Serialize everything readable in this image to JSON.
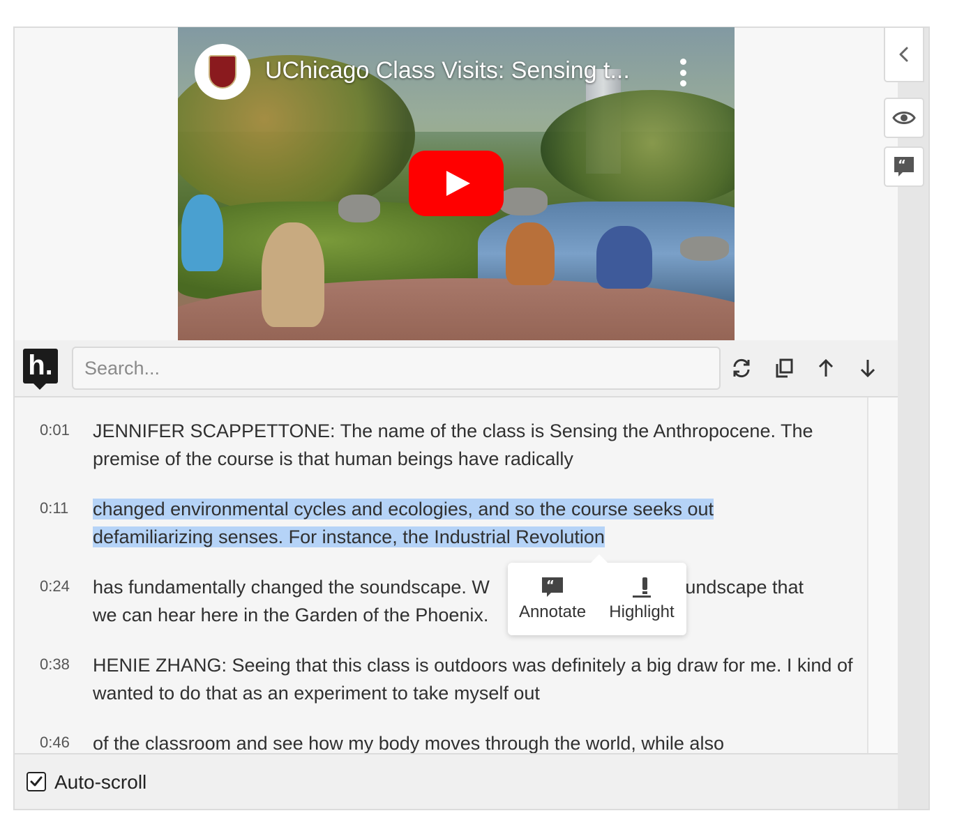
{
  "video": {
    "title": "UChicago Class Visits: Sensing t...",
    "channel_logo": "uchicago-shield-logo",
    "play_icon": "youtube-play-icon"
  },
  "sidebar": {
    "collapse_icon": "chevron-left-icon",
    "visibility_icon": "eye-icon",
    "annotations_icon": "quote-bubble-icon"
  },
  "toolbar": {
    "logo_text": "h.",
    "search_placeholder": "Search...",
    "icons": [
      "sync-icon",
      "copy-icon",
      "arrow-up-icon",
      "arrow-down-icon"
    ]
  },
  "transcript": [
    {
      "time": "0:01",
      "text": "JENNIFER SCAPPETTONE: The name of the class is Sensing the Anthropocene. The premise of the course is that human beings have radically"
    },
    {
      "time": "0:11",
      "text": "changed environmental cycles and ecologies, and so the course seeks out defamiliarizing senses. For instance, the Industrial Revolution",
      "highlighted": true
    },
    {
      "time": "0:24",
      "text_line1_start": "has fundamentally changed the soundscape. W",
      "text_line1_end": "soundscape that",
      "text_line2": "we can hear here in the Garden of the Phoenix."
    },
    {
      "time": "0:38",
      "text": "HENIE ZHANG: Seeing that this class is outdoors was definitely a big draw for me. I kind of wanted to do that as an experiment to take myself out"
    },
    {
      "time": "0:46",
      "text": "of the classroom and see how my body moves through the world, while also"
    }
  ],
  "popover": {
    "annotate_label": "Annotate",
    "highlight_label": "Highlight"
  },
  "footer": {
    "auto_scroll_label": "Auto-scroll",
    "auto_scroll_checked": true
  },
  "colors": {
    "highlight": "#b5d3f7",
    "youtube_red": "#ff0000"
  }
}
